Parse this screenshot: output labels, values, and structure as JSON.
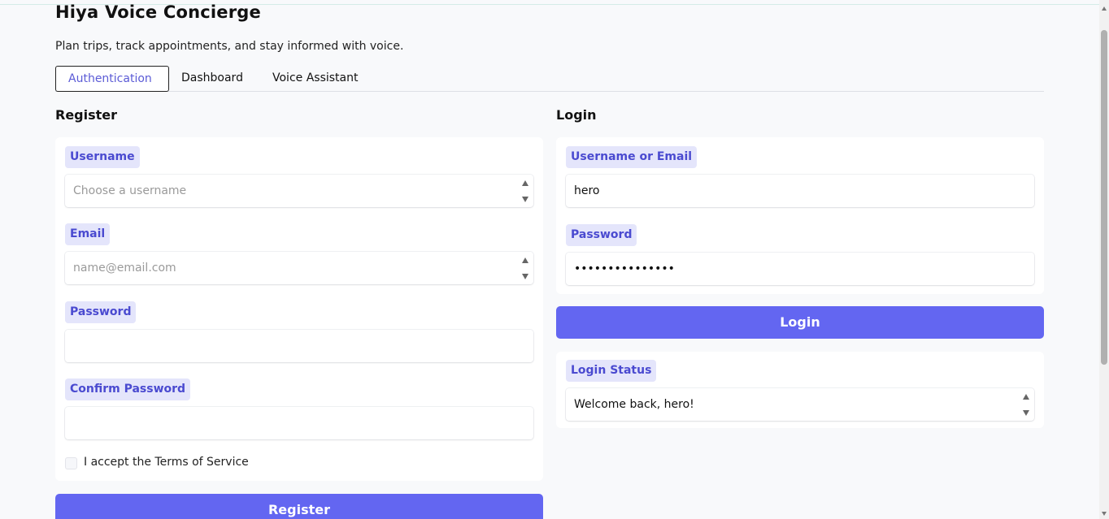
{
  "app": {
    "title": "Hiya Voice Concierge",
    "subtitle": "Plan trips, track appointments, and stay informed with voice."
  },
  "tabs": [
    {
      "label": "Authentication",
      "active": true
    },
    {
      "label": "Dashboard",
      "active": false
    },
    {
      "label": "Voice Assistant",
      "active": false
    }
  ],
  "register": {
    "title": "Register",
    "username_label": "Username",
    "username_placeholder": "Choose a username",
    "email_label": "Email",
    "email_placeholder": "name@email.com",
    "password_label": "Password",
    "confirm_label": "Confirm Password",
    "terms_label": "I accept the Terms of Service",
    "terms_checked": false,
    "button_label": "Register"
  },
  "login": {
    "title": "Login",
    "user_label": "Username or Email",
    "user_value": "hero",
    "password_label": "Password",
    "password_value": "•••••••••••••••",
    "button_label": "Login",
    "status_label": "Login Status",
    "status_value": "Welcome back, hero!"
  },
  "colors": {
    "accent": "#6366f1",
    "label_bg": "#e4e5fb",
    "label_text": "#4a4ad0",
    "page_bg": "#f8f9fb"
  }
}
